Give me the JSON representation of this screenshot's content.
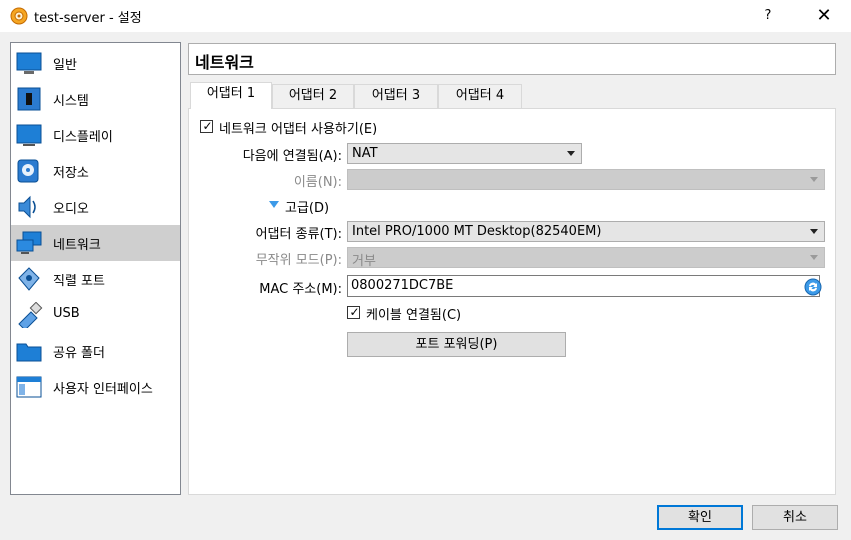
{
  "window": {
    "title": "test-server - 설정",
    "help_label": "?",
    "close_label": "✕"
  },
  "sidebar": {
    "items": [
      {
        "label": "일반"
      },
      {
        "label": "시스템"
      },
      {
        "label": "디스플레이"
      },
      {
        "label": "저장소"
      },
      {
        "label": "오디오"
      },
      {
        "label": "네트워크",
        "selected": true
      },
      {
        "label": "직렬 포트"
      },
      {
        "label": "USB"
      },
      {
        "label": "공유 폴더"
      },
      {
        "label": "사용자 인터페이스"
      }
    ]
  },
  "page": {
    "title": "네트워크"
  },
  "tabs": [
    {
      "label": "어댑터 1",
      "active": true
    },
    {
      "label": "어댑터 2"
    },
    {
      "label": "어댑터 3"
    },
    {
      "label": "어댑터 4"
    }
  ],
  "form": {
    "enable_adapter": {
      "label": "네트워크 어댑터 사용하기(E)",
      "checked": true
    },
    "attached_to": {
      "label": "다음에 연결됨(A):",
      "value": "NAT"
    },
    "name": {
      "label": "이름(N):",
      "value": ""
    },
    "advanced": {
      "label": "고급(D)"
    },
    "adapter_type": {
      "label": "어댑터 종류(T):",
      "value": "Intel PRO/1000 MT Desktop(82540EM)"
    },
    "promiscuous": {
      "label": "무작위 모드(P):",
      "value": "거부"
    },
    "mac": {
      "label": "MAC 주소(M):",
      "value": "0800271DC7BE"
    },
    "cable_connected": {
      "label": "케이블 연결됨(C)",
      "checked": true
    },
    "port_forwarding": {
      "label": "포트 포워딩(P)"
    }
  },
  "buttons": {
    "ok": "확인",
    "cancel": "취소"
  },
  "colors": {
    "accent": "#0078d7",
    "selected_item": "#cfcfcf",
    "window_bg": "#f0f0f0"
  }
}
